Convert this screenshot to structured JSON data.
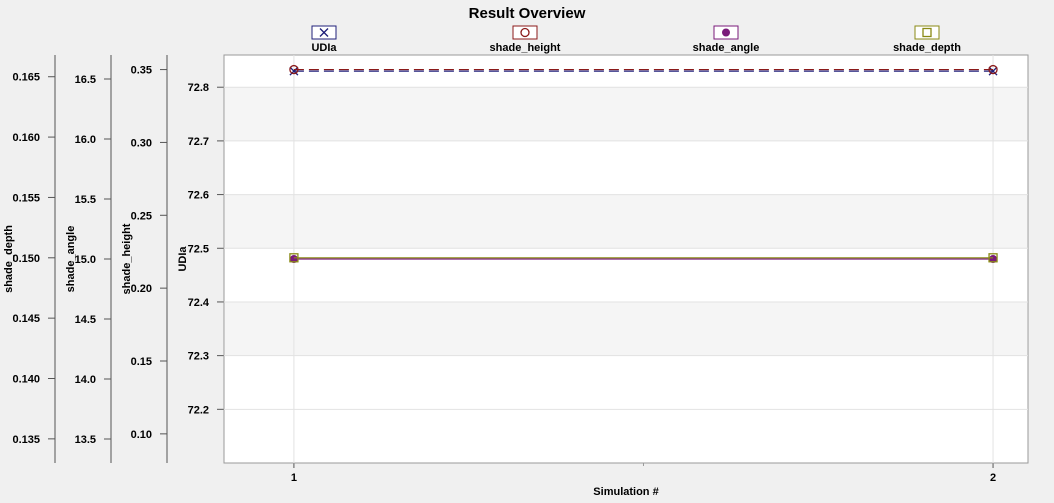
{
  "chart_data": {
    "type": "line",
    "title": "Result Overview",
    "xlabel": "Simulation #",
    "x": [
      1,
      2
    ],
    "xlim": [
      0.9,
      2.05
    ],
    "x_ticks": [
      "1",
      "2"
    ],
    "grid": true,
    "legend_position": "top",
    "axes": [
      {
        "name": "UDIa",
        "label": "UDIa",
        "ylim": [
          72.1,
          72.86
        ],
        "ticks": [
          "72.2",
          "72.3",
          "72.4",
          "72.5",
          "72.6",
          "72.7",
          "72.8"
        ],
        "tick_values": [
          72.2,
          72.3,
          72.4,
          72.5,
          72.6,
          72.7,
          72.8
        ]
      },
      {
        "name": "shade_height",
        "label": "shade_height",
        "ylim": [
          0.08,
          0.36
        ],
        "ticks": [
          "0.10",
          "0.15",
          "0.20",
          "0.25",
          "0.30",
          "0.35"
        ],
        "tick_values": [
          0.1,
          0.15,
          0.2,
          0.25,
          0.3,
          0.35
        ]
      },
      {
        "name": "shade_angle",
        "label": "shade_angle",
        "ylim": [
          13.3,
          16.7
        ],
        "ticks": [
          "13.5",
          "14.0",
          "14.5",
          "15.0",
          "15.5",
          "16.0",
          "16.5"
        ],
        "tick_values": [
          13.5,
          14.0,
          14.5,
          15.0,
          15.5,
          16.0,
          16.5
        ]
      },
      {
        "name": "shade_depth",
        "label": "shade_depth",
        "ylim": [
          0.133,
          0.1668
        ],
        "ticks": [
          "0.135",
          "0.140",
          "0.145",
          "0.150",
          "0.155",
          "0.160",
          "0.165"
        ],
        "tick_values": [
          0.135,
          0.14,
          0.145,
          0.15,
          0.155,
          0.16,
          0.165
        ]
      }
    ],
    "series": [
      {
        "name": "UDIa",
        "axis": "UDIa",
        "values": [
          72.83,
          72.83
        ],
        "color": "#1f1f7a",
        "marker": "x",
        "dashed": true
      },
      {
        "name": "shade_height",
        "axis": "shade_height",
        "values": [
          0.35,
          0.35
        ],
        "color": "#8b1a1a",
        "marker": "circle-open",
        "dashed": true
      },
      {
        "name": "shade_angle",
        "axis": "shade_angle",
        "values": [
          15.0,
          15.0
        ],
        "color": "#7a1a7a",
        "marker": "circle-filled",
        "dashed": false
      },
      {
        "name": "shade_depth",
        "axis": "shade_depth",
        "values": [
          0.15,
          0.15
        ],
        "color": "#8a8a14",
        "marker": "square-open",
        "dashed": false
      }
    ]
  }
}
